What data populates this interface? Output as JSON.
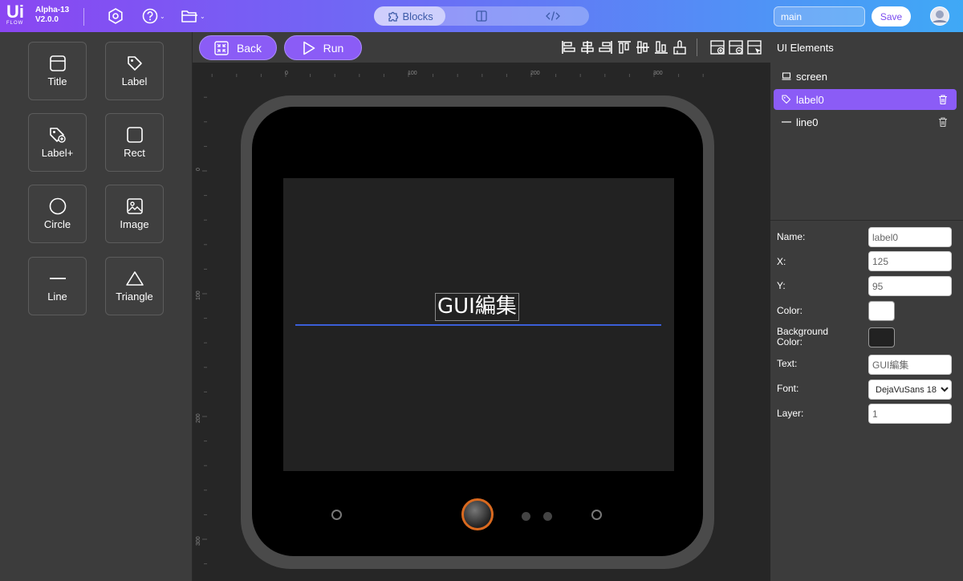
{
  "app": {
    "logo_main": "Ui",
    "logo_sub": "FLOW",
    "version_line1": "Alpha-13",
    "version_line2": "V2.0.0"
  },
  "topbar": {
    "icons": [
      "settings-icon",
      "help-icon",
      "folder-icon"
    ],
    "modes": [
      {
        "label": "Blocks",
        "icon": "puzzle-icon",
        "active": true
      },
      {
        "label": "",
        "icon": "split-view-icon",
        "active": false
      },
      {
        "label": "",
        "icon": "code-icon",
        "active": false
      }
    ],
    "filename_value": "main",
    "save_label": "Save"
  },
  "palette": {
    "items": [
      {
        "label": "Title",
        "icon": "title-icon"
      },
      {
        "label": "Label",
        "icon": "label-tag-icon"
      },
      {
        "label": "Label+",
        "icon": "label-plus-icon"
      },
      {
        "label": "Rect",
        "icon": "rect-icon"
      },
      {
        "label": "Circle",
        "icon": "circle-icon"
      },
      {
        "label": "Image",
        "icon": "image-icon"
      },
      {
        "label": "Line",
        "icon": "line-icon"
      },
      {
        "label": "Triangle",
        "icon": "triangle-icon"
      }
    ]
  },
  "canvas": {
    "back_label": "Back",
    "run_label": "Run",
    "ruler_top": [
      "0",
      "100",
      "200",
      "300"
    ],
    "ruler_left": [
      "0",
      "100",
      "200",
      "300"
    ],
    "label_text": "GUI編集",
    "line_color": "#3b5fd8",
    "button_ring_color": "#d9691f"
  },
  "elements": {
    "title": "UI Elements",
    "items": [
      {
        "name": "screen",
        "icon": "screen-icon",
        "selected": false,
        "deletable": false
      },
      {
        "name": "label0",
        "icon": "label-tag-icon",
        "selected": true,
        "deletable": true
      },
      {
        "name": "line0",
        "icon": "line-icon",
        "selected": false,
        "deletable": true
      }
    ]
  },
  "properties": {
    "name_label": "Name:",
    "name_value": "label0",
    "x_label": "X:",
    "x_value": "125",
    "y_label": "Y:",
    "y_value": "95",
    "color_label": "Color:",
    "color_value": "#ffffff",
    "bg_label_1": "Background",
    "bg_label_2": "Color:",
    "bg_value": "#222222",
    "text_label": "Text:",
    "text_value": "GUI編集",
    "font_label": "Font:",
    "font_value": "DejaVuSans 18",
    "layer_label": "Layer:",
    "layer_value": "1"
  },
  "colors": {
    "accent": "#8b5cf6",
    "save_text": "#7b4cf0"
  }
}
